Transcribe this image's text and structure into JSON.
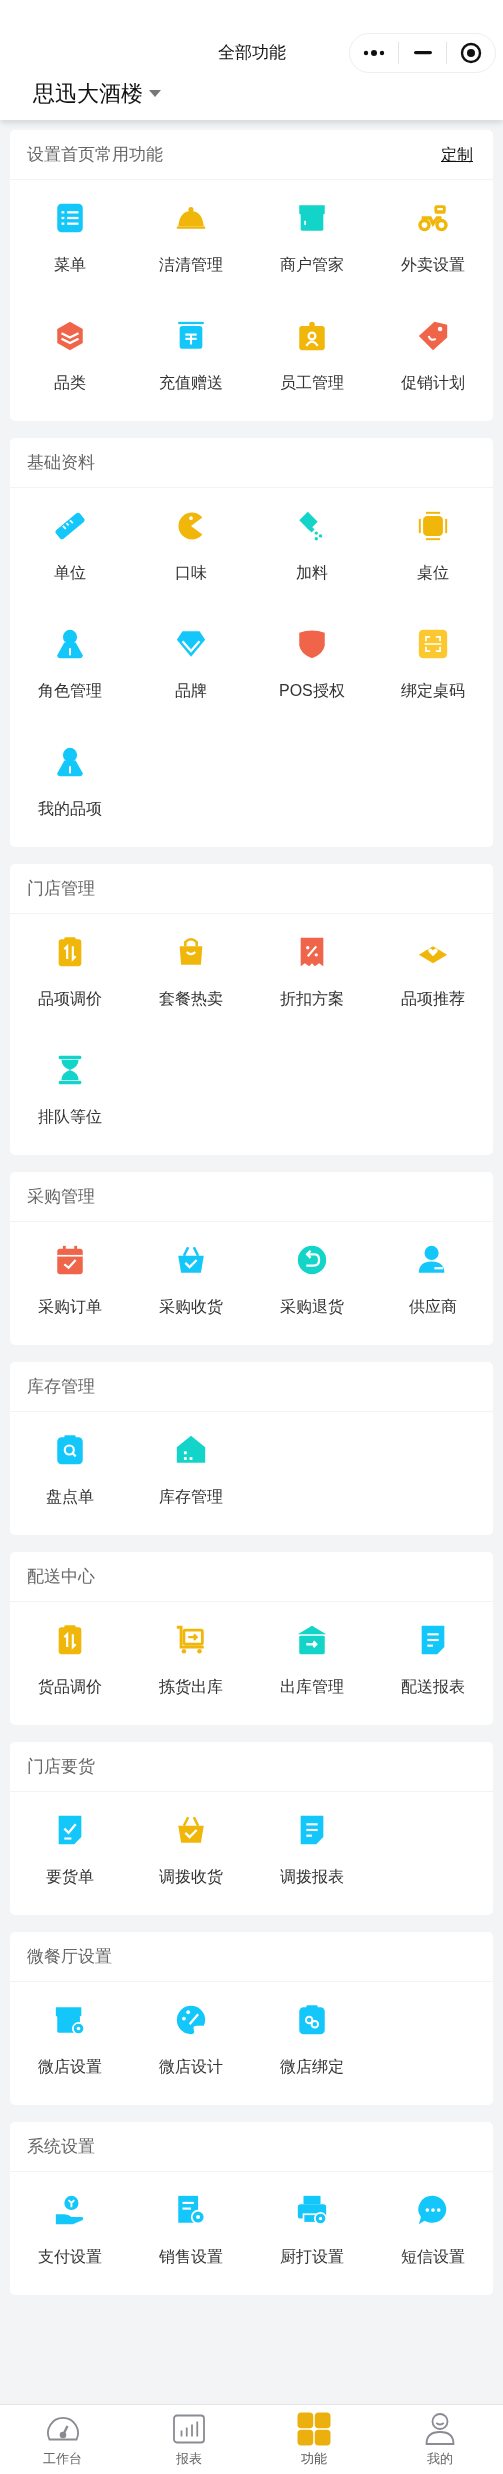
{
  "header": {
    "title": "全部功能",
    "store": "思迅大酒楼"
  },
  "sections": [
    {
      "title": "设置首页常用功能",
      "action": "定制",
      "items": [
        {
          "label": "菜单",
          "color": "#13c7fb"
        },
        {
          "label": "洁清管理",
          "color": "#f0b70a"
        },
        {
          "label": "商户管家",
          "color": "#13d4c9"
        },
        {
          "label": "外卖设置",
          "color": "#f0b70a"
        },
        {
          "label": "品类",
          "color": "#f0654a"
        },
        {
          "label": "充值赠送",
          "color": "#13c7fb"
        },
        {
          "label": "员工管理",
          "color": "#f0b70a"
        },
        {
          "label": "促销计划",
          "color": "#f0654a"
        }
      ]
    },
    {
      "title": "基础资料",
      "items": [
        {
          "label": "单位",
          "color": "#13c7fb"
        },
        {
          "label": "口味",
          "color": "#f0b70a"
        },
        {
          "label": "加料",
          "color": "#13d4c9"
        },
        {
          "label": "桌位",
          "color": "#f0b70a"
        },
        {
          "label": "角色管理",
          "color": "#13c7fb"
        },
        {
          "label": "品牌",
          "color": "#13c7fb"
        },
        {
          "label": "POS授权",
          "color": "#f0654a"
        },
        {
          "label": "绑定桌码",
          "color": "#fcc830"
        },
        {
          "label": "我的品项",
          "color": "#13c7fb"
        }
      ]
    },
    {
      "title": "门店管理",
      "items": [
        {
          "label": "品项调价",
          "color": "#f0b70a"
        },
        {
          "label": "套餐热卖",
          "color": "#f0b70a"
        },
        {
          "label": "折扣方案",
          "color": "#f0654a"
        },
        {
          "label": "品项推荐",
          "color": "#f0b70a"
        },
        {
          "label": "排队等位",
          "color": "#13d4c9"
        }
      ]
    },
    {
      "title": "采购管理",
      "items": [
        {
          "label": "采购订单",
          "color": "#f0654a"
        },
        {
          "label": "采购收货",
          "color": "#13c7fb"
        },
        {
          "label": "采购退货",
          "color": "#13d4c9"
        },
        {
          "label": "供应商",
          "color": "#13c7fb"
        }
      ]
    },
    {
      "title": "库存管理",
      "items": [
        {
          "label": "盘点单",
          "color": "#13c7fb"
        },
        {
          "label": "库存管理",
          "color": "#13d4c9"
        }
      ]
    },
    {
      "title": "配送中心",
      "items": [
        {
          "label": "货品调价",
          "color": "#f0b70a"
        },
        {
          "label": "拣货出库",
          "color": "#f0b70a"
        },
        {
          "label": "出库管理",
          "color": "#13d4c9"
        },
        {
          "label": "配送报表",
          "color": "#13c7fb"
        }
      ]
    },
    {
      "title": "门店要货",
      "items": [
        {
          "label": "要货单",
          "color": "#13c7fb"
        },
        {
          "label": "调拨收货",
          "color": "#f0b70a"
        },
        {
          "label": "调拨报表",
          "color": "#13c7fb"
        }
      ]
    },
    {
      "title": "微餐厅设置",
      "items": [
        {
          "label": "微店设置",
          "color": "#13c7fb"
        },
        {
          "label": "微店设计",
          "color": "#13c7fb"
        },
        {
          "label": "微店绑定",
          "color": "#13c7fb"
        }
      ]
    },
    {
      "title": "系统设置",
      "items": [
        {
          "label": "支付设置",
          "color": "#13c7fb"
        },
        {
          "label": "销售设置",
          "color": "#13c7fb"
        },
        {
          "label": "厨打设置",
          "color": "#13c7fb"
        },
        {
          "label": "短信设置",
          "color": "#13c7fb"
        }
      ]
    }
  ],
  "tabs": [
    {
      "label": "工作台",
      "selected": false
    },
    {
      "label": "报表",
      "selected": false
    },
    {
      "label": "功能",
      "selected": true
    },
    {
      "label": "我的",
      "selected": false
    }
  ]
}
